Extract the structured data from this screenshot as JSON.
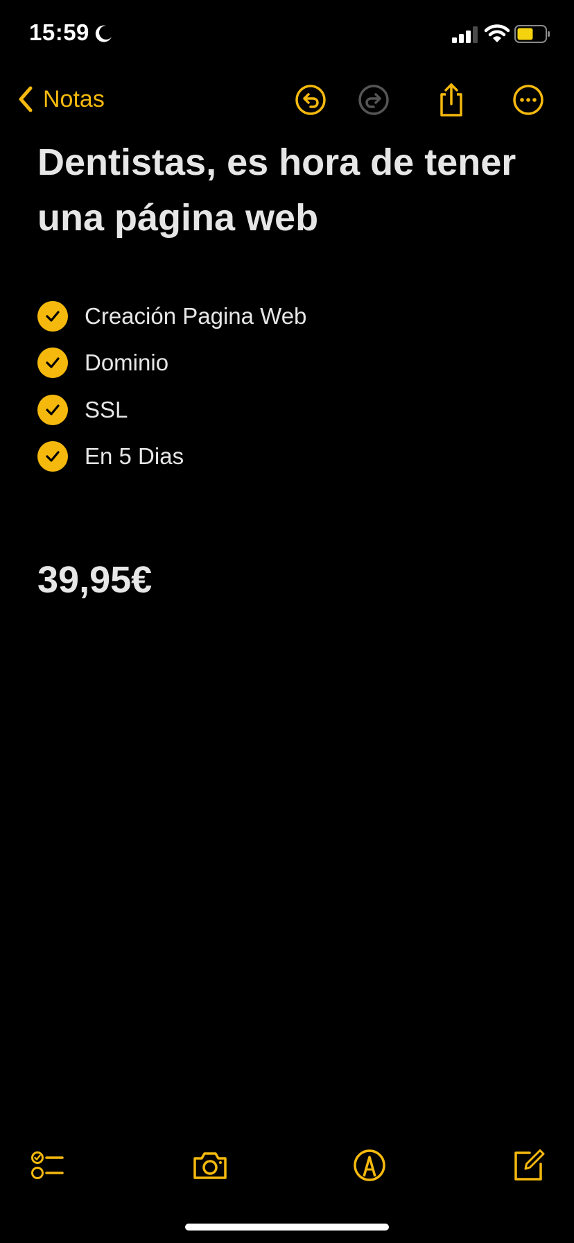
{
  "status_bar": {
    "time": "15:59",
    "icons": [
      "moon-icon",
      "signal-icon",
      "wifi-icon",
      "battery-icon"
    ]
  },
  "nav": {
    "back_label": "Notas",
    "icons": [
      "chevron-left-icon",
      "undo-icon",
      "redo-icon",
      "share-icon",
      "more-icon"
    ]
  },
  "note": {
    "title_line1": "Dentistas, es hora de tener",
    "title_line2": "una página web",
    "checklist": [
      {
        "label": "Creación Pagina Web",
        "checked": true
      },
      {
        "label": "Dominio",
        "checked": true
      },
      {
        "label": "SSL",
        "checked": true
      },
      {
        "label": "En 5 Dias",
        "checked": true
      }
    ],
    "price": "39,95€"
  },
  "toolbar": {
    "icons": [
      "checklist-icon",
      "camera-icon",
      "markup-pen-icon",
      "compose-icon"
    ]
  },
  "colors": {
    "accent": "#f5b90e",
    "background": "#000000",
    "text": "#e6e6e6",
    "disabled": "#555555"
  }
}
